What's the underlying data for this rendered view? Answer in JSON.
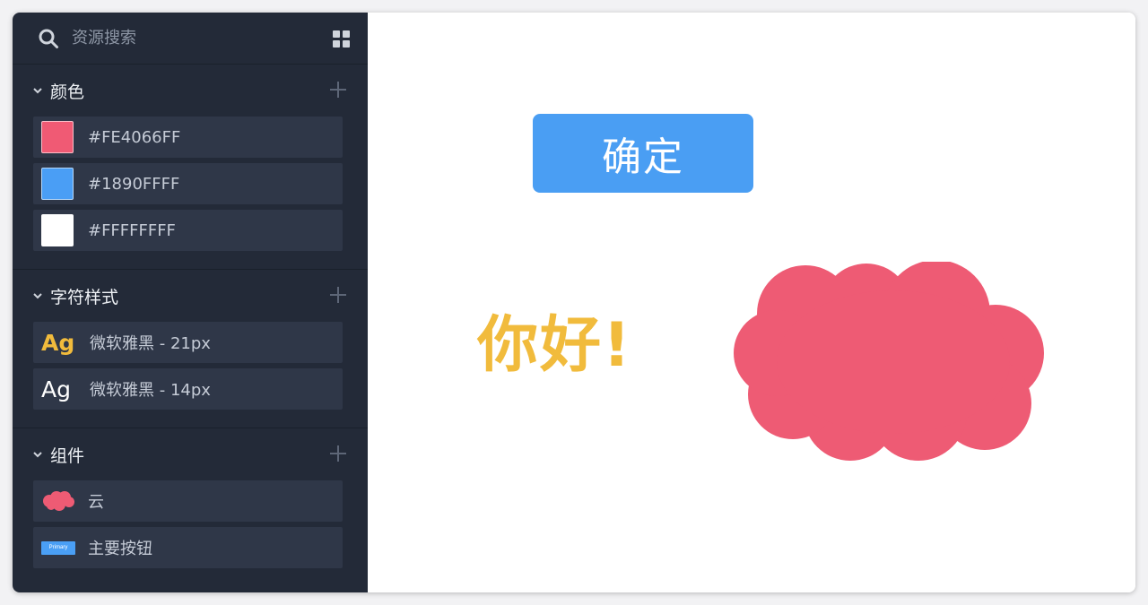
{
  "search": {
    "placeholder": "资源搜索",
    "icon": "search-icon"
  },
  "sidebar": {
    "colors": {
      "title": "颜色",
      "items": [
        {
          "label": "#FE4066FF",
          "hex": "#F05A74"
        },
        {
          "label": "#1890FFFF",
          "hex": "#4A9EF5"
        },
        {
          "label": "#FFFFFFFF",
          "hex": "#FFFFFF"
        }
      ]
    },
    "text_styles": {
      "title": "字符样式",
      "items": [
        {
          "sample": "Ag",
          "label": "微软雅黑 - 21px",
          "color": "#F1BB3C"
        },
        {
          "sample": "Ag",
          "label": "微软雅黑 - 14px",
          "color": "#FFFFFF"
        }
      ]
    },
    "components": {
      "title": "组件",
      "items": [
        {
          "label": "云",
          "thumb": "cloud-shape"
        },
        {
          "label": "主要按钮",
          "thumb_text": "Primary"
        }
      ]
    }
  },
  "canvas": {
    "button_label": "确定",
    "button_color": "#4A9EF3",
    "greeting": "你好!",
    "greeting_color": "#F1BB3C",
    "cloud_color": "#EE5B74"
  }
}
